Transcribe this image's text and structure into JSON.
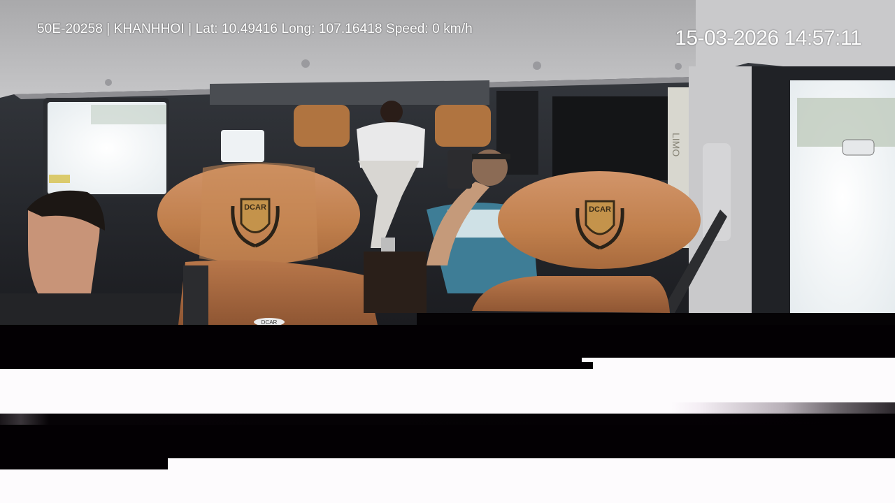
{
  "overlay": {
    "info_line": "50E-20258 | KHANHHOI | Lat: 10.49416 Long: 107.16418 Speed: 0 km/h",
    "timestamp": "15-03-2026 14:57:11"
  },
  "branding": {
    "headrest_logo_text": "DCAR",
    "seat_badge_text": "DCAR",
    "side_panel_text": "LIMO"
  },
  "colors": {
    "leather": "#c98a55",
    "roof": "#b9b9bb",
    "corruption_dark": "#030003",
    "corruption_light": "#fdfbfd"
  }
}
